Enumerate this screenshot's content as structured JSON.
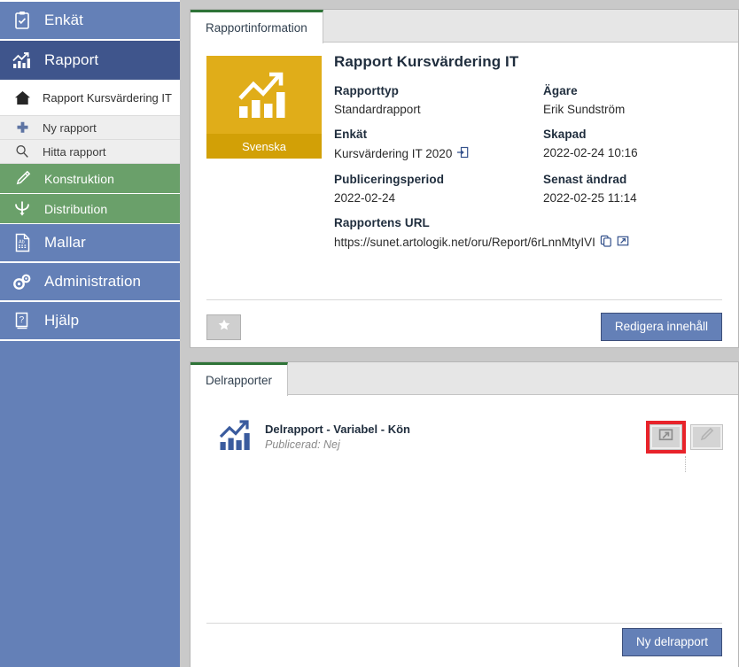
{
  "sidebar": {
    "main_items": [
      {
        "label": "Enkät",
        "icon": "clipboard-check-icon",
        "state": "normal"
      },
      {
        "label": "Rapport",
        "icon": "bar-chart-trend-icon",
        "state": "active"
      }
    ],
    "sub_items": [
      {
        "label": "Rapport Kursvärdering IT",
        "icon": "home-icon",
        "style": "home"
      },
      {
        "label": "Ny rapport",
        "icon": "plus-icon",
        "style": "plain"
      },
      {
        "label": "Hitta rapport",
        "icon": "search-icon",
        "style": "plain"
      }
    ],
    "green_items": [
      {
        "label": "Konstruktion",
        "icon": "pencil-icon"
      },
      {
        "label": "Distribution",
        "icon": "distribution-icon"
      }
    ],
    "bottom_items": [
      {
        "label": "Mallar",
        "icon": "template-document-icon"
      },
      {
        "label": "Administration",
        "icon": "gears-icon"
      },
      {
        "label": "Hjälp",
        "icon": "help-book-icon"
      }
    ]
  },
  "report_panel": {
    "tab_label": "Rapportinformation",
    "language_tile": {
      "language": "Svenska",
      "icon": "bar-chart-trend-icon",
      "color": "#e0ad19",
      "cap_color": "#d2a006"
    },
    "title": "Rapport Kursvärdering IT",
    "fields": [
      {
        "key": "Rapporttyp",
        "value": "Standardrapport",
        "icon": null
      },
      {
        "key": "Ägare",
        "value": "Erik Sundström",
        "icon": null
      },
      {
        "key": "Enkät",
        "value": "Kursvärdering IT 2020",
        "icon": "open-link-icon"
      },
      {
        "key": "Skapad",
        "value": "2022-02-24 10:16",
        "icon": null
      },
      {
        "key": "Publiceringsperiod",
        "value": "2022-02-24",
        "icon": null
      },
      {
        "key": "Senast ändrad",
        "value": "2022-02-25 11:14",
        "icon": null
      }
    ],
    "url_field": {
      "key": "Rapportens URL",
      "value": "https://sunet.artologik.net/oru/Report/6rLnnMtyIVI",
      "icons": [
        "copy-icon",
        "open-link-icon"
      ]
    },
    "favorite_button": {
      "icon": "star-icon"
    },
    "edit_button": {
      "label": "Redigera innehåll",
      "color": "#6480b7"
    }
  },
  "subreports_panel": {
    "tab_label": "Delrapporter",
    "rows": [
      {
        "icon": "bar-chart-trend-icon",
        "name": "Delrapport - Variabel - Kön",
        "status": "Publicerad: Nej",
        "actions": [
          {
            "icon": "open-link-icon",
            "highlighted": true
          },
          {
            "icon": "pencil-icon",
            "highlighted": false
          }
        ]
      }
    ],
    "new_button": {
      "label": "Ny delrapport",
      "color": "#6480b7"
    },
    "highlight_color": "#e8232a"
  }
}
